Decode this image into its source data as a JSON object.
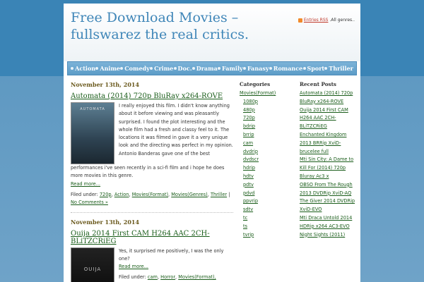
{
  "header": {
    "site_title": "Free Download Movies – fullswarez the real critics.",
    "rss_label": "Entries RSS",
    "all_genres": ".All genres.."
  },
  "nav": {
    "items": [
      "Action",
      "Anime",
      "Comedy",
      "Crime",
      "Doc.",
      "Drama",
      "Family",
      "Fanasy",
      "Romance",
      "Sport",
      "Thriller"
    ]
  },
  "posts": [
    {
      "date": "November 13th, 2014",
      "title": "Automata (2014) 720p BluRay x264-ROVE",
      "poster_text": "AUTOMATA",
      "text_short": "I really enjoyed this film. I didn't know anything about it before viewing and was pleasantly surprised. I found the plot interesting and the whole film had a fresh and classy feel to it. The locations it was filmed in gave it a very unique look and the directing was perfect in my opinion. Antonio Banderas gave one of the best",
      "text_full": "performances i've seen recently in a sci-fi film and i hope he does more movies in this genre.",
      "read_more": "Read more...",
      "filed_label": "Filed under:",
      "tags": [
        "720p",
        "Action",
        "Movies(Format)",
        "Movies(Genres)",
        "Thriller"
      ],
      "comments": "No Comments »"
    },
    {
      "date": "November 13th, 2014",
      "title": "Ouija 2014 First CAM H264 AAC 2CH-BLiTZCRiEG",
      "poster_text": "OUIJA",
      "text_short": "Yes, it surprised me positively, I was the only one?",
      "read_more": "Read more...",
      "filed_label": "Filed under:",
      "tags": [
        "cam",
        "Horror",
        "Movies(Format),"
      ]
    }
  ],
  "categories": {
    "title": "Categories",
    "items": [
      "Movies(Format)",
      "1080p",
      "480p",
      "720p",
      "bdrip",
      "brrip",
      "cam",
      "dvdrip",
      "dvdscr",
      "hdrip",
      "hdtv",
      "pdtv",
      "pdvd",
      "ppvrip",
      "sdtv",
      "tc",
      "ts",
      "tvrip"
    ]
  },
  "recent_posts": {
    "title": "Recent Posts",
    "items": [
      "Automata (2014) 720p",
      "BluRay x264-ROVE",
      "Ouija 2014 First CAM",
      "H264 AAC 2CH-",
      "BLiTZCRiEG",
      "Enchanted Kingdom",
      "2013 BRRip XviD-",
      "brucelee full",
      "Mti Sin City: A Dame to",
      "Kill For (2014) 720p",
      "Bluray Ac3 x",
      "OBSO From The Rough",
      "2013 DVDRip XviD-AQ",
      "The Giver 2014 DVDRip",
      "XviD-EVO",
      "Mti Draca Untold 2014",
      "HDRip x264 AC3-EVO",
      "Night Sights (2011)"
    ]
  }
}
